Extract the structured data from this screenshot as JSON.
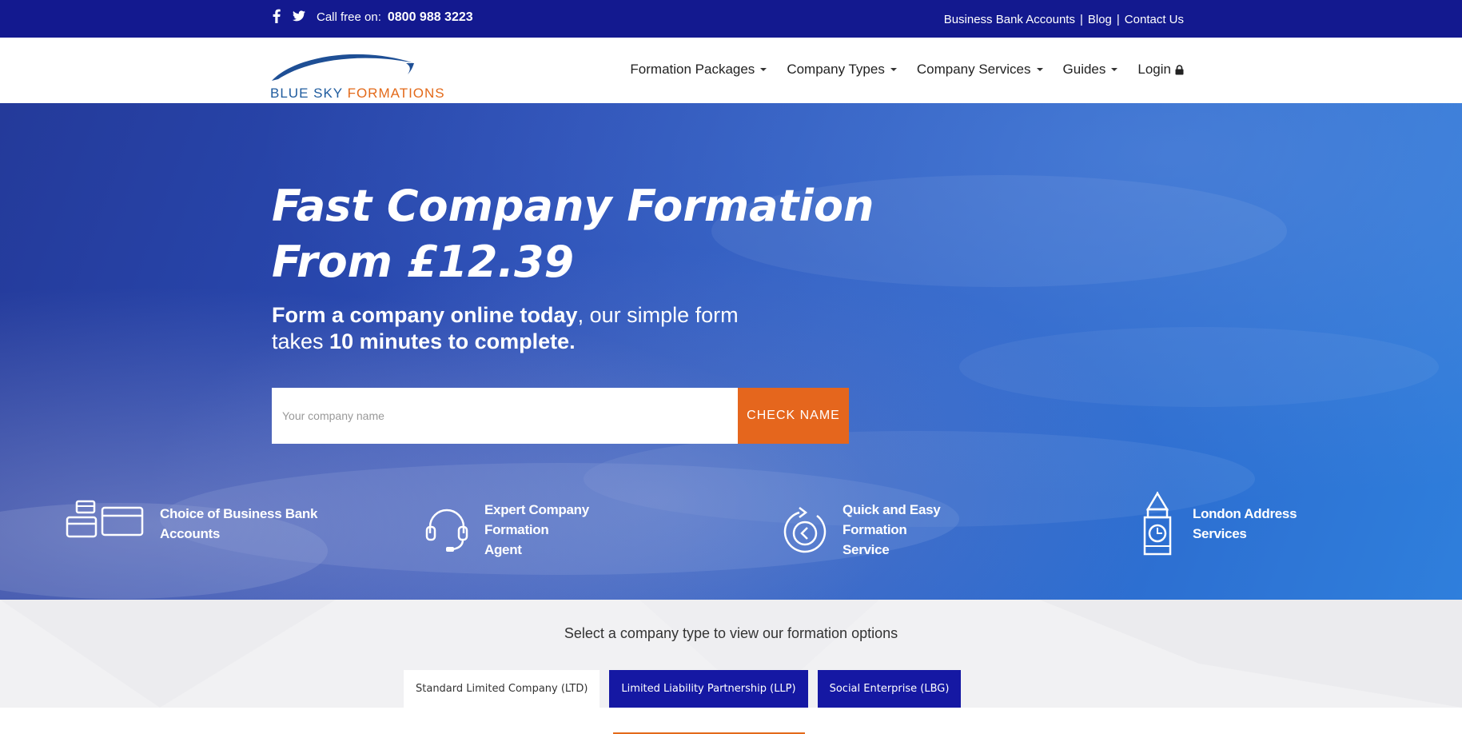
{
  "topbar": {
    "social_icons": [
      "facebook-icon",
      "twitter-icon"
    ],
    "call_label": "Call free on:",
    "phone": "0800 988 3223",
    "links": [
      "Business Bank Accounts",
      "Blog",
      "Contact Us"
    ],
    "separator": "|"
  },
  "logo": {
    "blue_text": "BLUE SKY",
    "orange_text": "FORMATIONS"
  },
  "nav": {
    "items": [
      "Formation Packages",
      "Company Types",
      "Company Services",
      "Guides"
    ],
    "login": "Login",
    "lock_icon": "lock-icon"
  },
  "hero": {
    "headline_line1": "Fast Company Formation",
    "headline_line2": "From £12.39",
    "sub_bold1": "Form a company online today",
    "sub_normal1": ", our simple form",
    "sub_normal2": "takes ",
    "sub_bold2": "10 minutes to complete.",
    "search_placeholder": "Your company name",
    "search_value": "",
    "button_label": "CHECK NAME"
  },
  "features": [
    {
      "icon": "bank-cards-icon",
      "line1": "Choice of Business Bank",
      "line2": "Accounts"
    },
    {
      "icon": "headset-icon",
      "line1": "Expert Company Formation",
      "line2": "Agent"
    },
    {
      "icon": "fast-forward-icon",
      "line1": "Quick and Easy Formation",
      "line2": "Service"
    },
    {
      "icon": "big-ben-icon",
      "line1": "London Address Services",
      "line2": ""
    }
  ],
  "lower": {
    "title": "Select a company type to view our formation options",
    "tabs": [
      {
        "label": "Standard Limited Company (LTD)",
        "active": true
      },
      {
        "label": "Limited Liability Partnership (LLP)",
        "active": false
      },
      {
        "label": "Social Enterprise (LBG)",
        "active": false
      }
    ]
  },
  "colors": {
    "topbar": "#13198f",
    "accent_orange": "#e5661d",
    "tab_blue": "#1518a3",
    "hero_blue": "#2b63c9"
  }
}
